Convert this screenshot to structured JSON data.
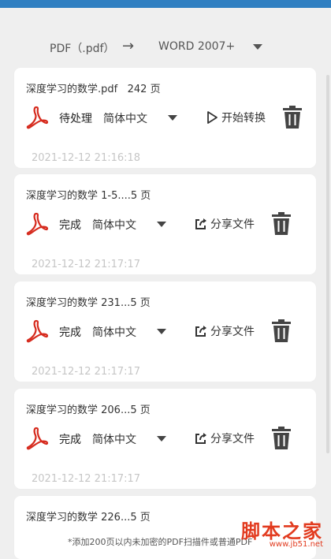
{
  "format": {
    "source": "PDF（.pdf）",
    "arrow": "→",
    "target": "WORD 2007+"
  },
  "cards": [
    {
      "title": "深度学习的数学.pdf",
      "pages": "242 页",
      "status": "待处理",
      "language": "简体中文",
      "action": "开始转换",
      "time": "2021-12-12 21:16:18"
    },
    {
      "title": "深度学习的数学 1-5....",
      "pages": "5 页",
      "status": "完成",
      "language": "简体中文",
      "action": "分享文件",
      "time": "2021-12-12 21:17:17"
    },
    {
      "title": "深度学习的数学 231...",
      "pages": "5 页",
      "status": "完成",
      "language": "简体中文",
      "action": "分享文件",
      "time": "2021-12-12 21:17:17"
    },
    {
      "title": "深度学习的数学 206...",
      "pages": "5 页",
      "status": "完成",
      "language": "简体中文",
      "action": "分享文件",
      "time": "2021-12-12 21:17:17"
    },
    {
      "title": "深度学习的数学 226...",
      "pages": "5 页"
    }
  ],
  "footer": {
    "note": "*添加200页以内未加密的PDF扫描件或普通PDF"
  },
  "watermark": {
    "logo": "脚本之家",
    "url": "www.jb51.net"
  },
  "colors": {
    "accent_bar": "#2f7fc1",
    "pdf_icon": "#d62b1e",
    "watermark": "#e23b1f"
  },
  "icons": {
    "pdf": "acrobat-pdf-icon",
    "play": "play-outline-icon",
    "share": "share-out-icon",
    "delete": "trash-icon"
  }
}
